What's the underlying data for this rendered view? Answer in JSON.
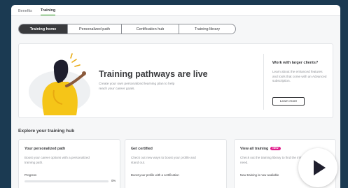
{
  "topbar": {
    "tabs": [
      {
        "label": "Benefits"
      },
      {
        "label": "Training"
      }
    ]
  },
  "segments": [
    {
      "label": "Training home"
    },
    {
      "label": "Personalized path"
    },
    {
      "label": "Certification hub"
    },
    {
      "label": "Training library"
    }
  ],
  "hero": {
    "title": "Training pathways are live",
    "subtitle": "Create your own personalized learning plan to help reach your career goals.",
    "side_title": "Work with larger clients?",
    "side_body": "Learn about the enhanced features and tools that come with an Advanced subscription.",
    "learn_more": "Learn more"
  },
  "explore": {
    "title": "Explore your training hub",
    "cards": [
      {
        "title": "Your personalized path",
        "body": "Boost your career options with a personalized training path.",
        "meta": "Progress",
        "progress": 0,
        "progress_label": "0%"
      },
      {
        "title": "Get certified",
        "body": "Check out new ways to boost your profile and stand out.",
        "meta": "Boost your profile with a certification"
      },
      {
        "title": "View all training",
        "badge": "NEW",
        "body": "Check out the training library to find the info you need.",
        "meta": "New training is now available"
      }
    ]
  },
  "colors": {
    "background": "#1b3a52",
    "accent_green": "#2ca01c",
    "badge_pink": "#e01e8c",
    "illustration_yellow": "#f5c518"
  },
  "icons": {
    "play": "play-icon"
  }
}
